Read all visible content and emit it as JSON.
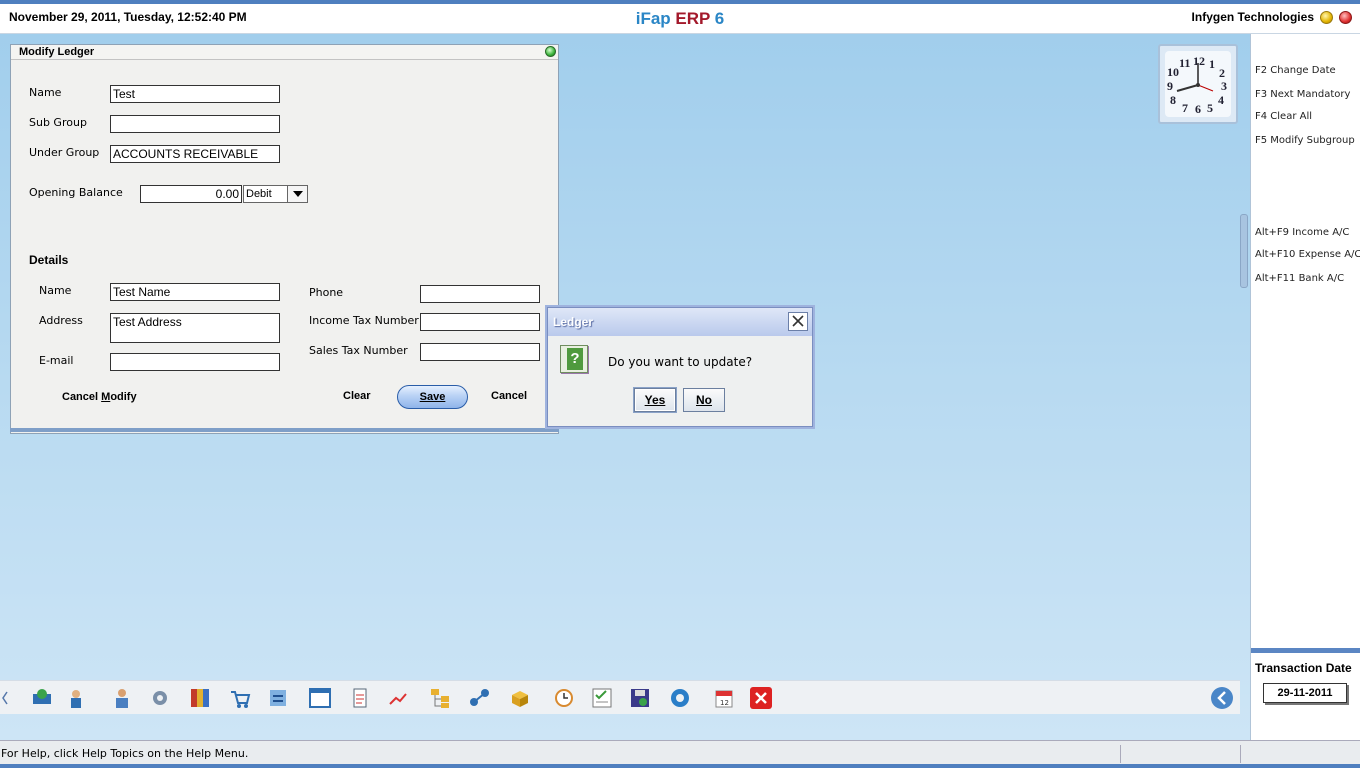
{
  "header": {
    "datetime": "November  29, 2011, Tuesday, 12:52:40 PM",
    "app_prefix": "iFap",
    "app_erp": "ERP",
    "app_version": "6",
    "company": "Infygen Technologies"
  },
  "colors": {
    "title_blue": "#2a86c6",
    "erp_red": "#a3192b",
    "background": "#b8daf1",
    "accent": "#4f7fbf"
  },
  "shortcuts": [
    "F2 Change Date",
    "F3 Next Mandatory",
    "F4 Clear All",
    "F5 Modify Subgroup",
    "Alt+F9 Income A/C",
    "Alt+F10 Expense A/C",
    "Alt+F11 Bank A/C"
  ],
  "transaction": {
    "label": "Transaction Date",
    "value": "29-11-2011"
  },
  "clock": {
    "numerals": [
      "12",
      "1",
      "2",
      "3",
      "4",
      "5",
      "6",
      "7",
      "8",
      "9",
      "10",
      "11"
    ],
    "time_shown": "12:52:40"
  },
  "ledger": {
    "title": "Modify Ledger",
    "name_label": "Name",
    "name_value": "Test",
    "subgroup_label": "Sub Group",
    "subgroup_value": "",
    "undergroup_label": "Under Group",
    "undergroup_value": "ACCOUNTS RECEIVABLE",
    "opening_label": "Opening Balance",
    "opening_value": "0.00",
    "opening_type": "Debit",
    "details_label": "Details",
    "d_name_label": "Name",
    "d_name_value": "Test Name",
    "address_label": "Address",
    "address_value": "Test Address",
    "email_label": "E-mail",
    "email_value": "",
    "phone_label": "Phone",
    "phone_value": "",
    "itn_label": "Income Tax Number",
    "itn_value": "",
    "stn_label": "Sales Tax Number",
    "stn_value": "",
    "cancel_modify_a": "Cancel ",
    "cancel_modify_m": "M",
    "cancel_modify_b": "odify",
    "clear": "Clear",
    "save": "Save",
    "cancel": "Cancel"
  },
  "dialog": {
    "title": "Ledger",
    "message": "Do you want to update?",
    "yes": "Yes",
    "no": "No",
    "icon": "question-icon"
  },
  "toolbar_icons": [
    "masters-icon",
    "customer-icon",
    "users-icon",
    "settings-gear-icon",
    "books-icon",
    "cart-icon",
    "transfer-icon",
    "window-icon",
    "document-icon",
    "chart-icon",
    "tree-icon",
    "network-icon",
    "package-icon",
    "clock-hand-icon",
    "checklist-icon",
    "save-disk-icon",
    "gear-icon",
    "calendar-icon",
    "close-icon"
  ],
  "status": {
    "help": "For Help, click Help Topics on the Help Menu."
  }
}
